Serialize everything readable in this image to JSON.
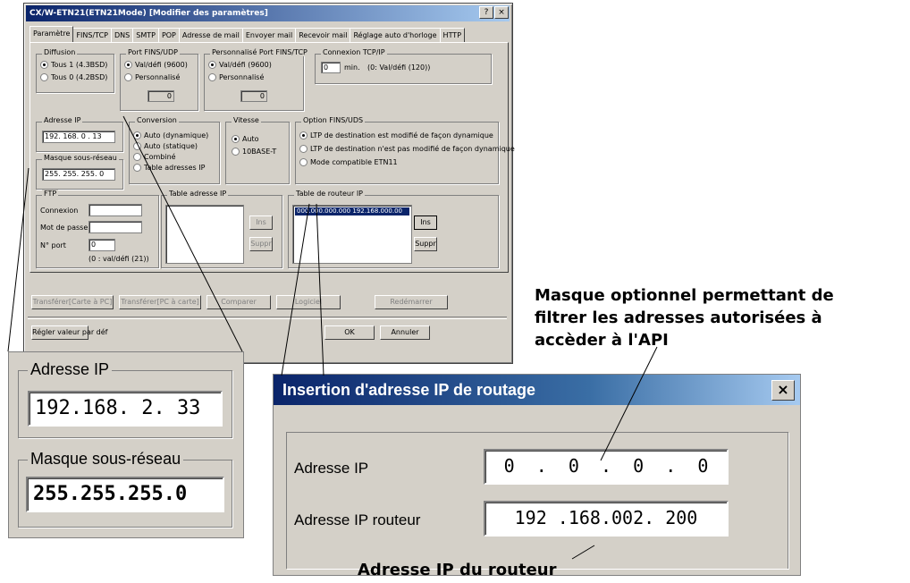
{
  "window": {
    "title": "CX/W-ETN21(ETN21Mode) [Modifier des paramètres]",
    "help_btn": "?",
    "close_btn": "×",
    "tabs": [
      "Paramètre",
      "FINS/TCP",
      "DNS",
      "SMTP",
      "POP",
      "Adresse de mail",
      "Envoyer mail",
      "Recevoir mail",
      "Réglage auto d'horloge",
      "HTTP"
    ]
  },
  "diffusion": {
    "label": "Diffusion",
    "opt1": "Tous 1 (4.3BSD)",
    "opt2": "Tous 0 (4.2BSD)"
  },
  "port_fins_udp": {
    "label": "Port FINS/UDP",
    "opt1": "Val/défi (9600)",
    "opt2": "Personnalisé",
    "value": "0"
  },
  "port_fins_tcp": {
    "label": "Personnalisé Port FINS/TCP",
    "opt1": "Val/défi (9600)",
    "opt2": "Personnalisé",
    "value": "0"
  },
  "connexion_tcp": {
    "label": "Connexion TCP/IP",
    "value": "0",
    "unit": "min.",
    "hint": "(0: Val/défi (120))"
  },
  "adresse_ip": {
    "label": "Adresse IP",
    "value": "192. 168. 0 . 13"
  },
  "masque": {
    "label": "Masque sous-réseau",
    "value": "255. 255. 255. 0"
  },
  "conversion": {
    "label": "Conversion",
    "opt1": "Auto (dynamique)",
    "opt2": "Auto (statique)",
    "opt3": "Combiné",
    "opt4": "Table adresses IP"
  },
  "vitesse": {
    "label": "Vitesse",
    "opt1": "Auto",
    "opt2": "10BASE-T"
  },
  "option_fins": {
    "label": "Option FINS/UDS",
    "opt1": "LTP de destination est modifié de façon dynamique",
    "opt2": "LTP de destination n'est pas modifié de façon dynamique",
    "opt3": "Mode compatible ETN11"
  },
  "ftp": {
    "label": "FTP",
    "connexion": "Connexion",
    "mdp": "Mot de passe",
    "port": "N° port",
    "port_value": "0",
    "port_hint": "(0 : val/défi (21))"
  },
  "table_adresse": {
    "label": "Table adresse IP",
    "ins": "Ins",
    "suppr": "Suppr"
  },
  "table_routeur": {
    "label": "Table de routeur IP",
    "entry": "000.000.000.000 192.168.000.00",
    "ins": "Ins",
    "suppr": "Suppr"
  },
  "bottom": {
    "b1": "Transférer[Carte à PC]",
    "b2": "Transférer[PC à carte]",
    "b3": "Comparer",
    "b4": "Logiciel",
    "b5": "Redémarrer",
    "regler": "Régler valeur par déf",
    "ok": "OK",
    "annuler": "Annuler"
  },
  "zoom_left": {
    "ip_label": "Adresse IP",
    "ip_value": "192.168.  2. 33",
    "mask_label": "Masque sous-réseau",
    "mask_value": "255.255.255.0"
  },
  "zoom_right": {
    "title": "Insertion d'adresse IP de routage",
    "close": "×",
    "row1_label": "Adresse IP",
    "row1_value": "0  .  0  .  0  .  0",
    "row2_label": "Adresse IP routeur",
    "row2_value": "192 .168.002. 200"
  },
  "annotations": {
    "mask_note_l1": "Masque optionnel permettant de",
    "mask_note_l2": "filtrer les adresses autorisées  à",
    "mask_note_l3": "accèder à l'API",
    "router_note": "Adresse IP du routeur"
  }
}
